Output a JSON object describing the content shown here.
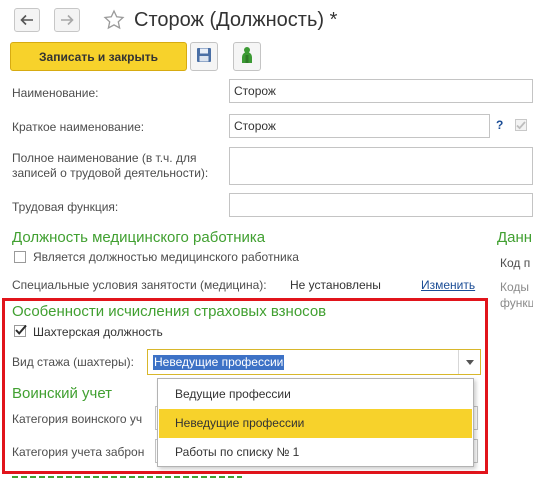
{
  "window": {
    "title": "Сторож (Должность) *"
  },
  "toolbar": {
    "save_close_label": "Записать и закрыть"
  },
  "form": {
    "name_label": "Наименование:",
    "name_value": "Сторож",
    "short_name_label": "Краткое наименование:",
    "short_name_value": "Сторож",
    "help_mark": "?",
    "full_name_label_line1": "Полное наименование (в т.ч. для",
    "full_name_label_line2": "записей о трудовой деятельности):",
    "full_name_value": "",
    "labor_function_label": "Трудовая функция:",
    "labor_function_value": ""
  },
  "medical": {
    "section_title": "Должность медицинского работника",
    "is_medical_label": "Является должностью медицинского работника",
    "is_medical_checked": false,
    "special_conditions_label": "Специальные условия занятости (медицина):",
    "special_conditions_value": "Не установлены",
    "change_link": "Изменить"
  },
  "right_panel": {
    "section_title": "Данн",
    "code_label": "Код п",
    "line2": "Коды",
    "line3": "функц"
  },
  "insurance": {
    "section_title": "Особенности исчисления страховых взносов",
    "miner_label": "Шахтерская должность",
    "miner_checked": true,
    "experience_label": "Вид стажа (шахтеры):",
    "experience_value": "Неведущие профессии",
    "options": [
      "Ведущие профессии",
      "Неведущие профессии",
      "Работы по списку № 1"
    ],
    "selected_option_index": 1
  },
  "military": {
    "section_title": "Воинский учет",
    "category_label": "Категория воинского уч",
    "reservation_label": "Категория учета заброн"
  },
  "colors": {
    "accent_yellow": "#f7d22b",
    "section_green": "#41a031",
    "highlight_red": "#e1141b",
    "selection_blue": "#3d72c6"
  }
}
